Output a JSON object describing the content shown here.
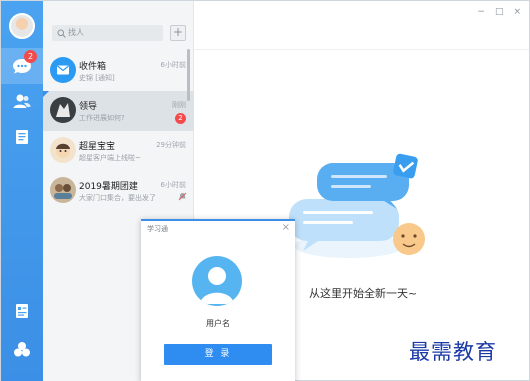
{
  "search": {
    "placeholder": "找人",
    "add_icon": "plus-icon"
  },
  "rail": {
    "chat_badge": "2",
    "icons": [
      "avatar",
      "chat-icon",
      "contacts-icon",
      "notes-icon",
      "addressbook-icon",
      "apps-icon"
    ]
  },
  "conversations": [
    {
      "name": "收件箱",
      "preview": "史锦 [通知]",
      "time": "6小时前",
      "badge": "",
      "avatar_color": "#2b9af3"
    },
    {
      "name": "领导",
      "preview": "工作进展如何?",
      "time": "刚刚",
      "badge": "2",
      "avatar_color": "#3a3f44"
    },
    {
      "name": "超星宝宝",
      "preview": "超星客户端上线啦~",
      "time": "29分钟前",
      "badge": "",
      "avatar_color": "#e8c8a0"
    },
    {
      "name": "2019暑期团建",
      "preview": "大家门口集合，要出发了",
      "time": "6小时前",
      "badge": "",
      "avatar_color": "#c9b59a"
    }
  ],
  "main": {
    "welcome": "从这里开始全新一天~",
    "window_controls": [
      "−",
      "□",
      "×"
    ],
    "watermark": "最需教育"
  },
  "dialog": {
    "title": "学习通",
    "close": "×",
    "username": "用户名",
    "login_label": "登 录"
  },
  "colors": {
    "accent": "#3b8fe6",
    "badge": "#f24b4b",
    "login": "#2f8cf0"
  }
}
